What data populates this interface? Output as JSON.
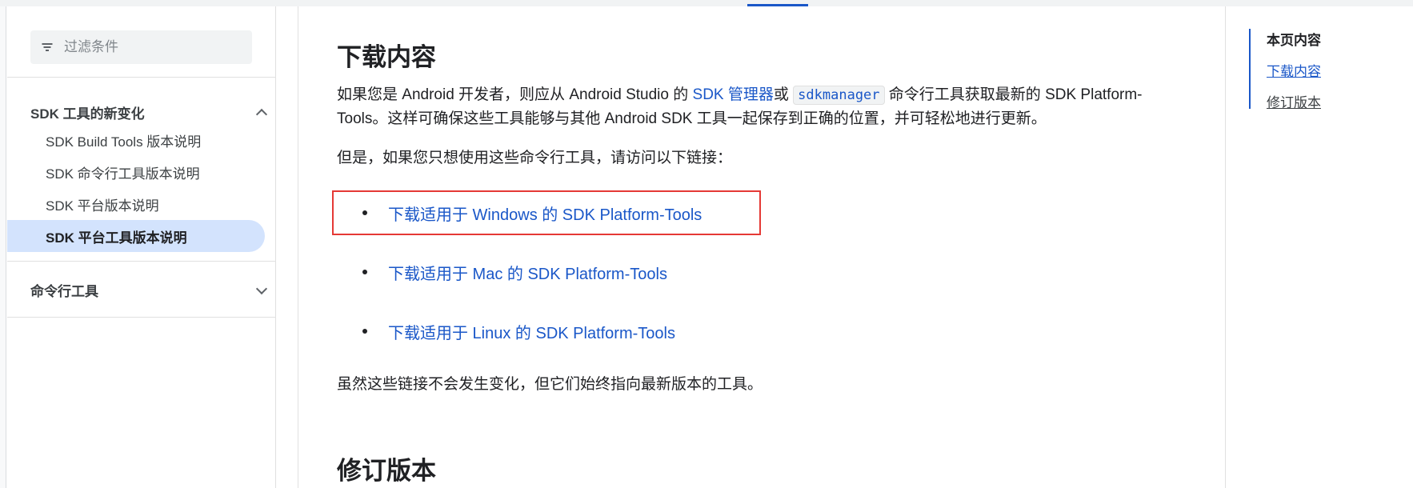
{
  "sidebar": {
    "filter_placeholder": "过滤条件",
    "section_sdk_tools": "SDK 工具的新变化",
    "items": [
      {
        "label": "SDK Build Tools 版本说明"
      },
      {
        "label": "SDK 命令行工具版本说明"
      },
      {
        "label": "SDK 平台版本说明"
      },
      {
        "label": "SDK 平台工具版本说明"
      }
    ],
    "section_cmdline": "命令行工具"
  },
  "main": {
    "download_heading": "下载内容",
    "intro_part1": "如果您是 Android 开发者，则应从 Android Studio 的 ",
    "intro_link": "SDK 管理器",
    "intro_part2": "或 ",
    "intro_code": "sdkmanager",
    "intro_part3": " 命令行工具获取最新的 SDK Platform-Tools。这样可确保这些工具能够与其他 Android SDK 工具一起保存到正确的位置，并可轻松地进行更新。",
    "cmdline_note": "但是，如果您只想使用这些命令行工具，请访问以下链接：",
    "links": [
      {
        "label": "下载适用于 Windows 的 SDK Platform-Tools"
      },
      {
        "label": "下载适用于 Mac 的 SDK Platform-Tools"
      },
      {
        "label": "下载适用于 Linux 的 SDK Platform-Tools"
      }
    ],
    "stable_note": "虽然这些链接不会发生变化，但它们始终指向最新版本的工具。",
    "revisions_heading": "修订版本"
  },
  "toc": {
    "title": "本页内容",
    "items": [
      {
        "label": "下载内容"
      },
      {
        "label": "修订版本"
      }
    ]
  },
  "colors": {
    "link": "#1a57c8",
    "active_nav_bg": "#d3e3fd",
    "highlight_border": "#e53935"
  }
}
